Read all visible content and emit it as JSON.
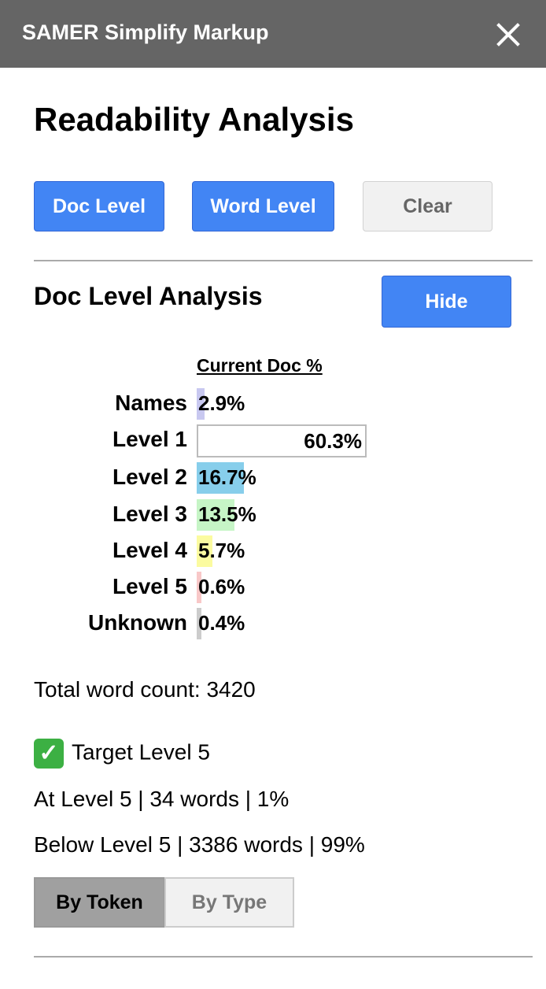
{
  "window": {
    "title": "SAMER Simplify Markup",
    "close_icon": "close-icon"
  },
  "heading": "Readability Analysis",
  "toolbar": {
    "doc_level_label": "Doc Level",
    "word_level_label": "Word Level",
    "clear_label": "Clear"
  },
  "doc_analysis": {
    "title": "Doc Level Analysis",
    "hide_label": "Hide",
    "column_header": "Current Doc %",
    "rows": [
      {
        "label": "Names",
        "pct_text": "2.9%",
        "value": 2.9,
        "color": "#c8c8f0"
      },
      {
        "label": "Level 1",
        "pct_text": "60.3%",
        "value": 60.3,
        "color": "#ffffff"
      },
      {
        "label": "Level 2",
        "pct_text": "16.7%",
        "value": 16.7,
        "color": "#87ceeb"
      },
      {
        "label": "Level 3",
        "pct_text": "13.5%",
        "value": 13.5,
        "color": "#c6f5c6"
      },
      {
        "label": "Level 4",
        "pct_text": "5.7%",
        "value": 5.7,
        "color": "#fbfba0"
      },
      {
        "label": "Level 5",
        "pct_text": "0.6%",
        "value": 0.6,
        "color": "#f8c8c8"
      },
      {
        "label": "Unknown",
        "pct_text": "0.4%",
        "value": 0.4,
        "color": "#cccccc"
      }
    ],
    "total_word_count": "Total word count: 3420",
    "target_level": "Target Level 5",
    "at_level": "At Level 5 | 34 words | 1%",
    "below_level": "Below Level 5 | 3386 words | 99%",
    "by_token_label": "By Token",
    "by_type_label": "By Type"
  },
  "colors": {
    "titlebar": "#656565",
    "accent_blue": "#4285f4",
    "check_green": "#3cb043"
  }
}
